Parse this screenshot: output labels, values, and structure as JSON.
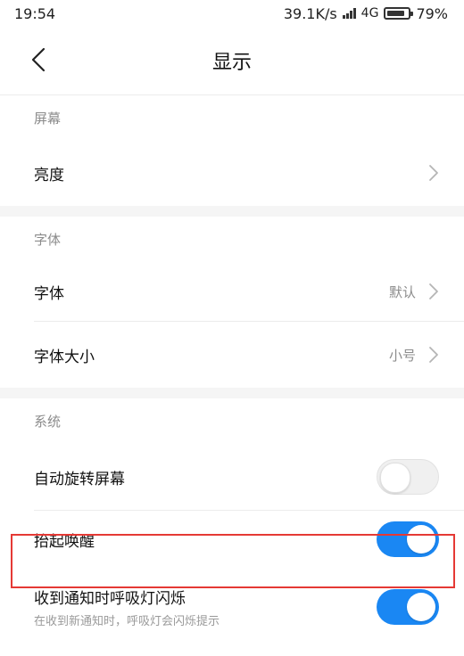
{
  "status_bar": {
    "time": "19:54",
    "net_speed": "39.1K/s",
    "network": "4G",
    "battery": "79%"
  },
  "header": {
    "title": "显示"
  },
  "sections": {
    "screen": {
      "title": "屏幕",
      "brightness_label": "亮度"
    },
    "font": {
      "title": "字体",
      "font_label": "字体",
      "font_value": "默认",
      "font_size_label": "字体大小",
      "font_size_value": "小号"
    },
    "system": {
      "title": "系统",
      "auto_rotate_label": "自动旋转屏幕",
      "auto_rotate_on": false,
      "raise_wake_label": "抬起唤醒",
      "raise_wake_on": true,
      "notify_light_label": "收到通知时呼吸灯闪烁",
      "notify_light_sub": "在收到新通知时，呼吸灯会闪烁提示",
      "notify_light_on": true
    }
  },
  "colors": {
    "accent": "#1a87f3",
    "highlight": "#e53935"
  }
}
